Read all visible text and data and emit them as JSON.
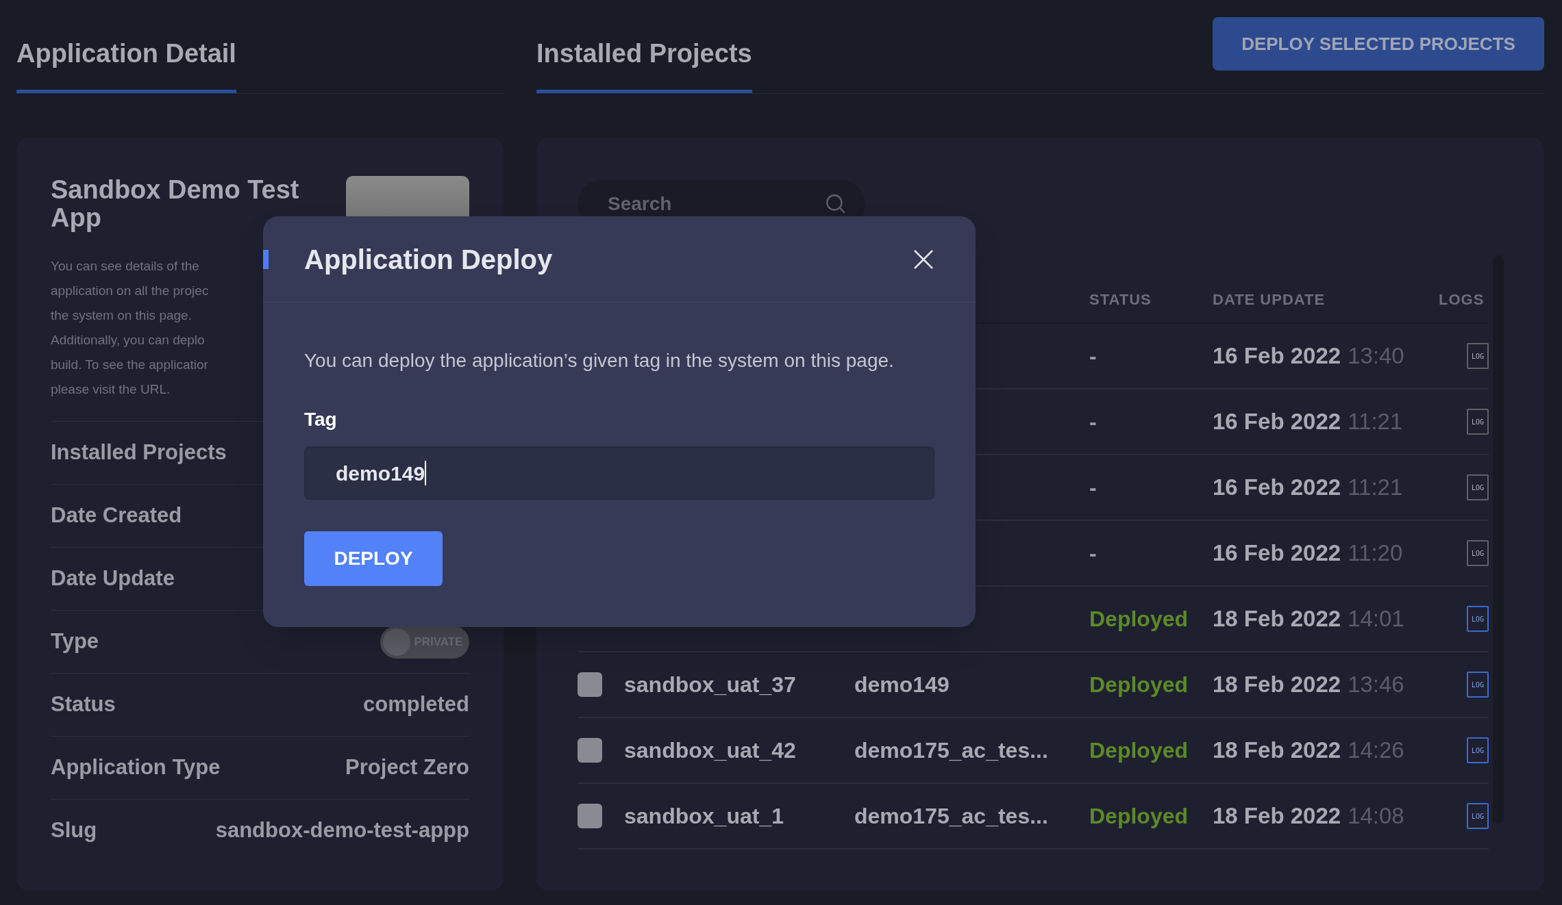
{
  "tabs": [
    {
      "label": "Application Detail",
      "selected": true
    },
    {
      "label": "Installed Projects",
      "selected": true
    }
  ],
  "deploy_selected_button": "DEPLOY SELECTED PROJECTS",
  "app": {
    "name": "Sandbox Demo Test App",
    "description_lines": [
      "You can see details of the",
      "application on all the projec",
      "the system on this page.",
      "Additionally, you can deplo",
      "build. To see the applicatior",
      "please visit the URL."
    ],
    "details": [
      {
        "label": "Installed Projects",
        "kind": "text"
      },
      {
        "label": "Date Created",
        "kind": "text"
      },
      {
        "label": "Date Update",
        "kind": "text"
      },
      {
        "label": "Type",
        "kind": "toggle",
        "toggle_label": "PRIVATE",
        "on": false
      },
      {
        "label": "Status",
        "kind": "text",
        "value": "completed"
      },
      {
        "label": "Application Type",
        "kind": "text",
        "value": "Project Zero"
      },
      {
        "label": "Slug",
        "kind": "text",
        "value": "sandbox-demo-test-appp"
      }
    ]
  },
  "search": {
    "placeholder": "Search"
  },
  "table": {
    "columns": [
      {
        "label": "STATUS"
      },
      {
        "label": "DATE UPDATE"
      },
      {
        "label": "LOGS"
      }
    ],
    "rows": [
      {
        "status": "-",
        "deployed": false,
        "date": "16 Feb 2022",
        "time": "13:40",
        "log": "LOG",
        "log_enabled": false
      },
      {
        "status": "-",
        "deployed": false,
        "date": "16 Feb 2022",
        "time": "11:21",
        "log": "LOG",
        "log_enabled": false
      },
      {
        "status": "-",
        "deployed": false,
        "date": "16 Feb 2022",
        "time": "11:21",
        "log": "LOG",
        "log_enabled": false
      },
      {
        "status": "-",
        "deployed": false,
        "date": "16 Feb 2022",
        "time": "11:20",
        "log": "LOG",
        "log_enabled": false
      },
      {
        "status": "Deployed",
        "deployed": true,
        "date": "18 Feb 2022",
        "time": "14:01",
        "log": "LOG",
        "log_enabled": true
      },
      {
        "checked": false,
        "project": "sandbox_uat_37",
        "tag": "demo149",
        "status": "Deployed",
        "deployed": true,
        "date": "18 Feb 2022",
        "time": "13:46",
        "log": "LOG",
        "log_enabled": true
      },
      {
        "checked": false,
        "project": "sandbox_uat_42",
        "tag": "demo175_ac_tes...",
        "status": "Deployed",
        "deployed": true,
        "date": "18 Feb 2022",
        "time": "14:26",
        "log": "LOG",
        "log_enabled": true
      },
      {
        "checked": false,
        "project": "sandbox_uat_1",
        "tag": "demo175_ac_tes...",
        "status": "Deployed",
        "deployed": true,
        "date": "18 Feb 2022",
        "time": "14:08",
        "log": "LOG",
        "log_enabled": true
      }
    ]
  },
  "modal": {
    "title": "Application Deploy",
    "description": "You can deploy the application’s given tag in the system on this page.",
    "field_label": "Tag",
    "field_value": "demo149",
    "button": "DEPLOY"
  }
}
